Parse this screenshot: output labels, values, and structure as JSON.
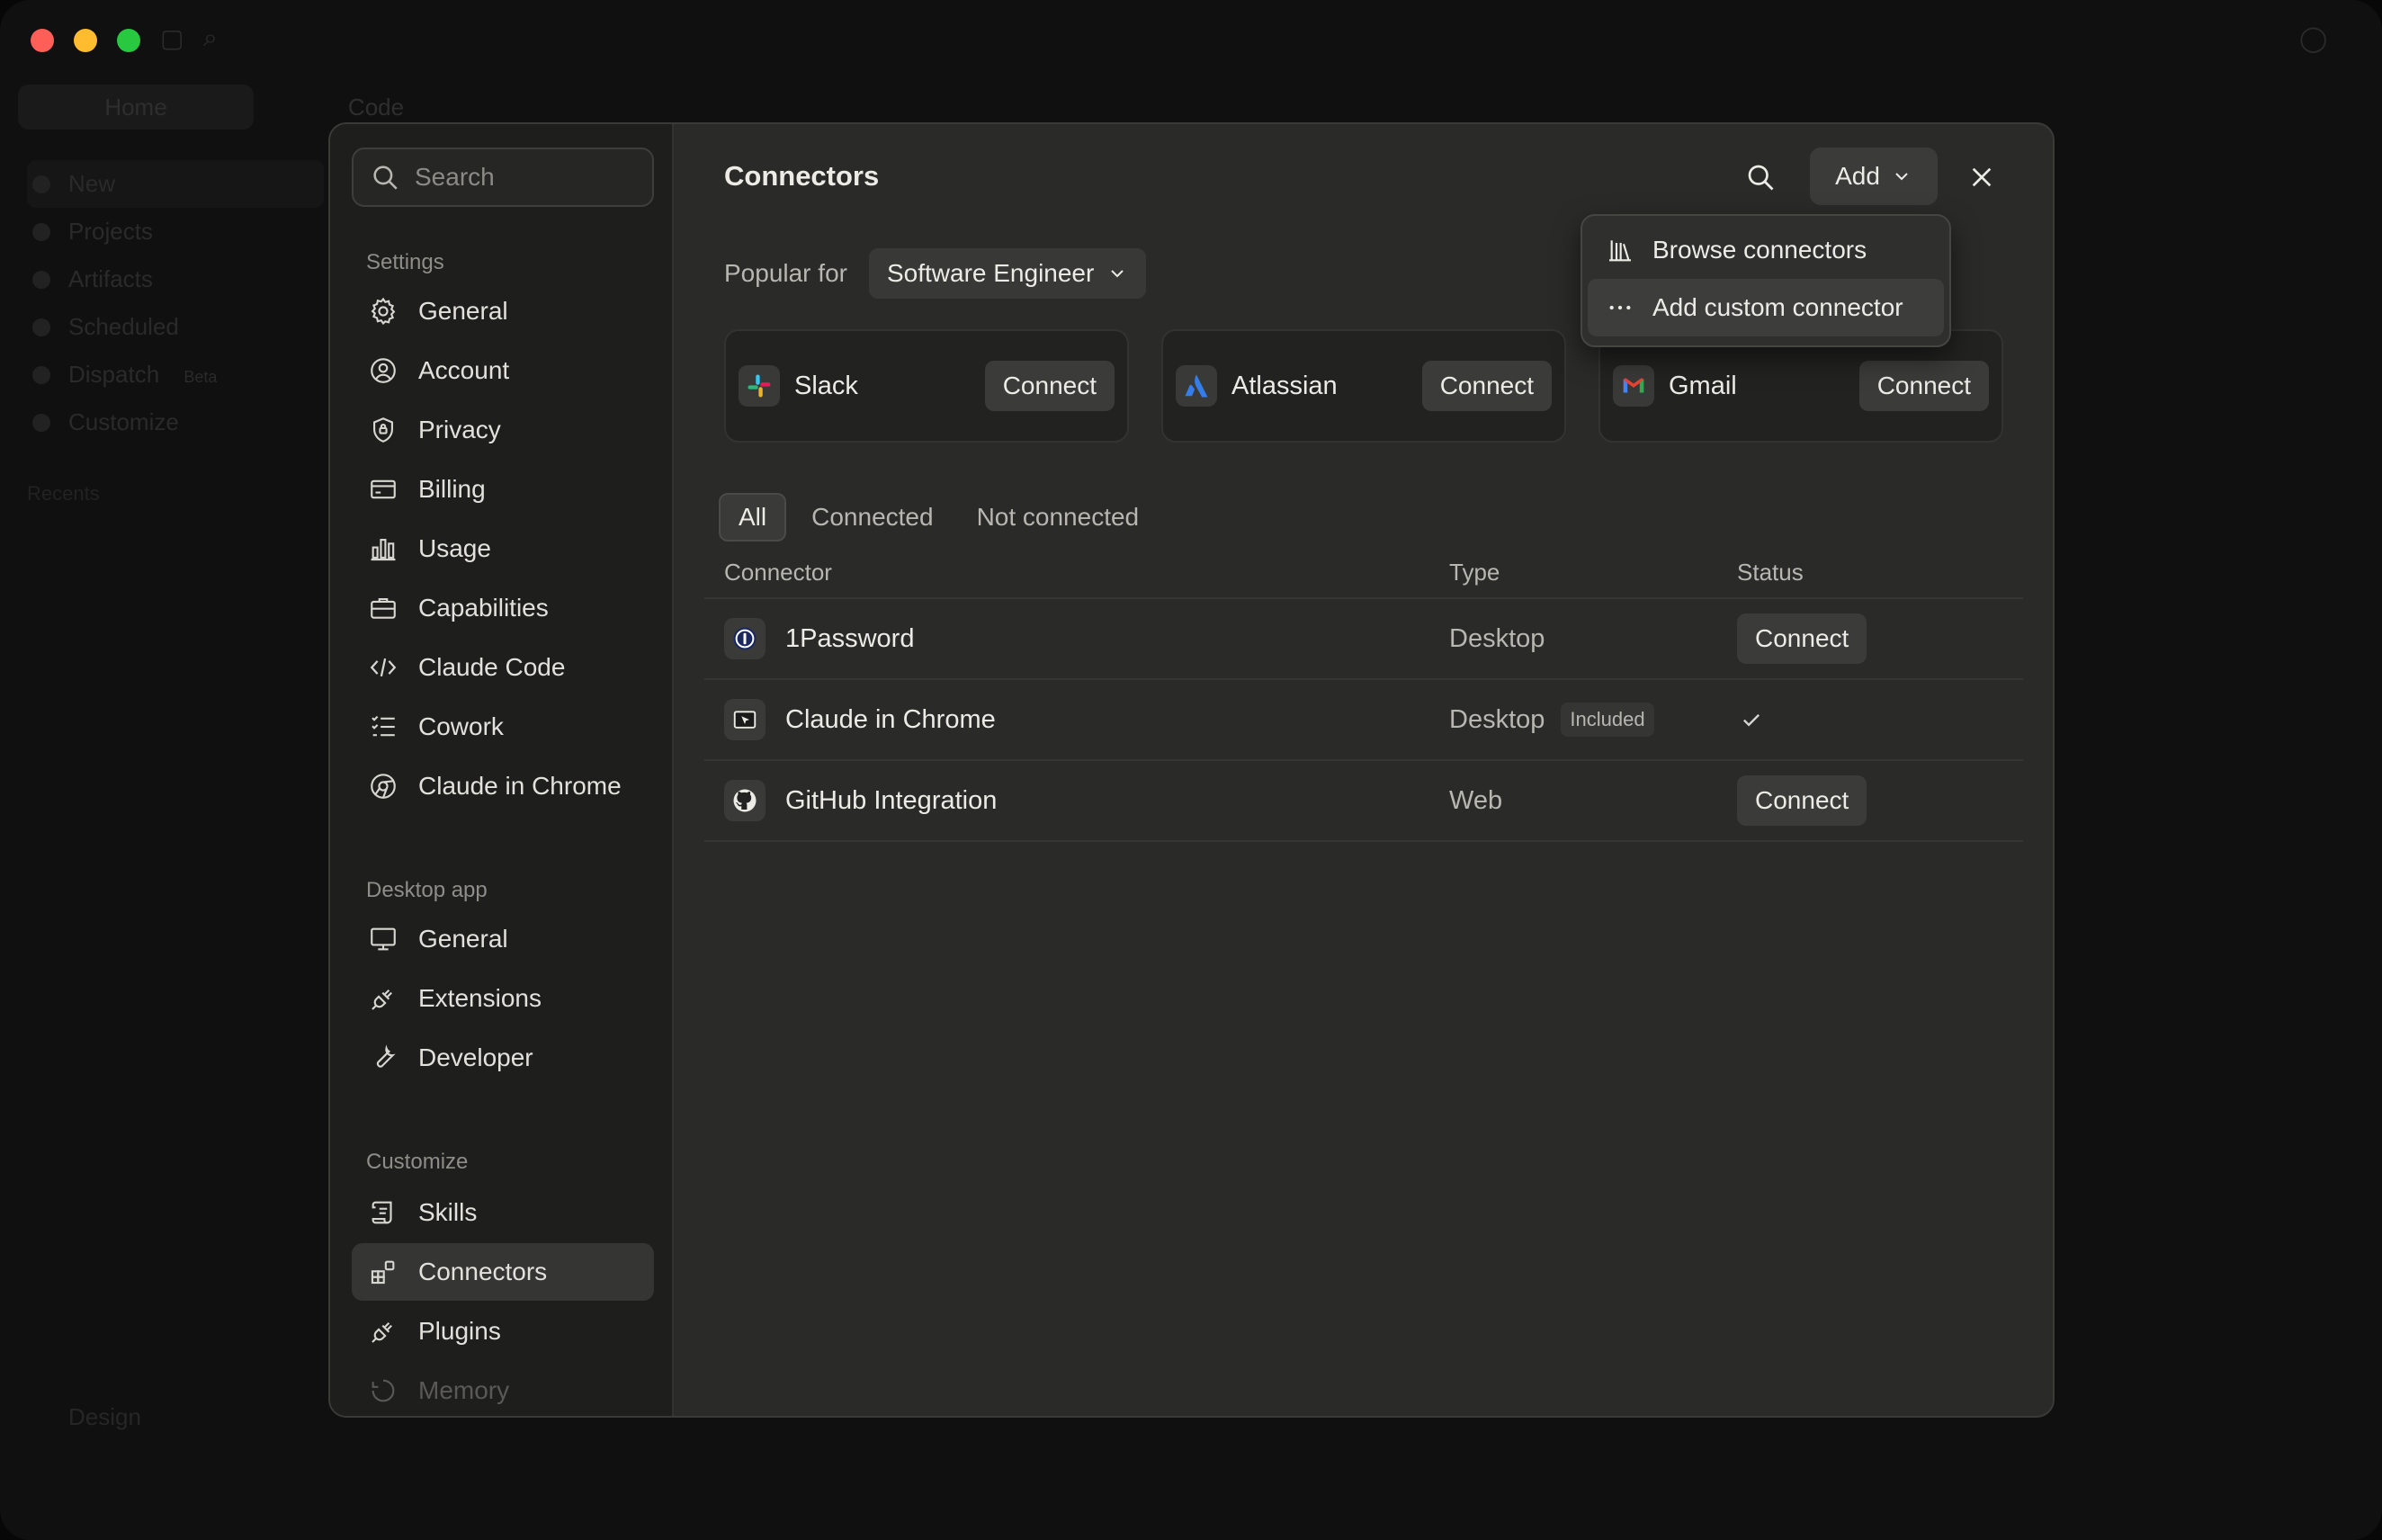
{
  "background_app": {
    "tabs": [
      "Home",
      "Code"
    ],
    "sidebar": [
      "New",
      "Projects",
      "Artifacts",
      "Scheduled",
      "Dispatch",
      "Customize"
    ],
    "beta_badge": "Beta",
    "recents_label": "Recents",
    "bottom_item": "Design"
  },
  "sidebar": {
    "search_placeholder": "Search",
    "settings_header": "Settings",
    "settings_items": [
      "General",
      "Account",
      "Privacy",
      "Billing",
      "Usage",
      "Capabilities",
      "Claude Code",
      "Cowork",
      "Claude in Chrome"
    ],
    "desktop_header": "Desktop app",
    "desktop_items": [
      "General",
      "Extensions",
      "Developer"
    ],
    "customize_header": "Customize",
    "customize_items": [
      "Skills",
      "Connectors",
      "Plugins",
      "Memory"
    ],
    "active_item": "Connectors"
  },
  "main": {
    "title": "Connectors",
    "add_label": "Add",
    "popular_label": "Popular for",
    "role_selected": "Software Engineer",
    "cards": [
      {
        "name": "Slack",
        "button": "Connect"
      },
      {
        "name": "Atlassian",
        "button": "Connect"
      },
      {
        "name": "Gmail",
        "button": "Connect"
      }
    ],
    "tabs": [
      "All",
      "Connected",
      "Not connected"
    ],
    "active_tab": "All",
    "table_headers": [
      "Connector",
      "Type",
      "Status"
    ],
    "rows": [
      {
        "name": "1Password",
        "type": "Desktop",
        "status": "Connect"
      },
      {
        "name": "Claude in Chrome",
        "type": "Desktop",
        "badge": "Included",
        "status": "connected"
      },
      {
        "name": "GitHub Integration",
        "type": "Web",
        "status": "Connect"
      }
    ]
  },
  "dropdown": {
    "items": [
      "Browse connectors",
      "Add custom connector"
    ]
  },
  "colors": {
    "dialog_bg": "#2a2a29",
    "sidebar_bg": "#1e1e1d",
    "button_bg": "#3b3b39",
    "text": "#ecebe6",
    "muted": "#b8b6b0"
  }
}
